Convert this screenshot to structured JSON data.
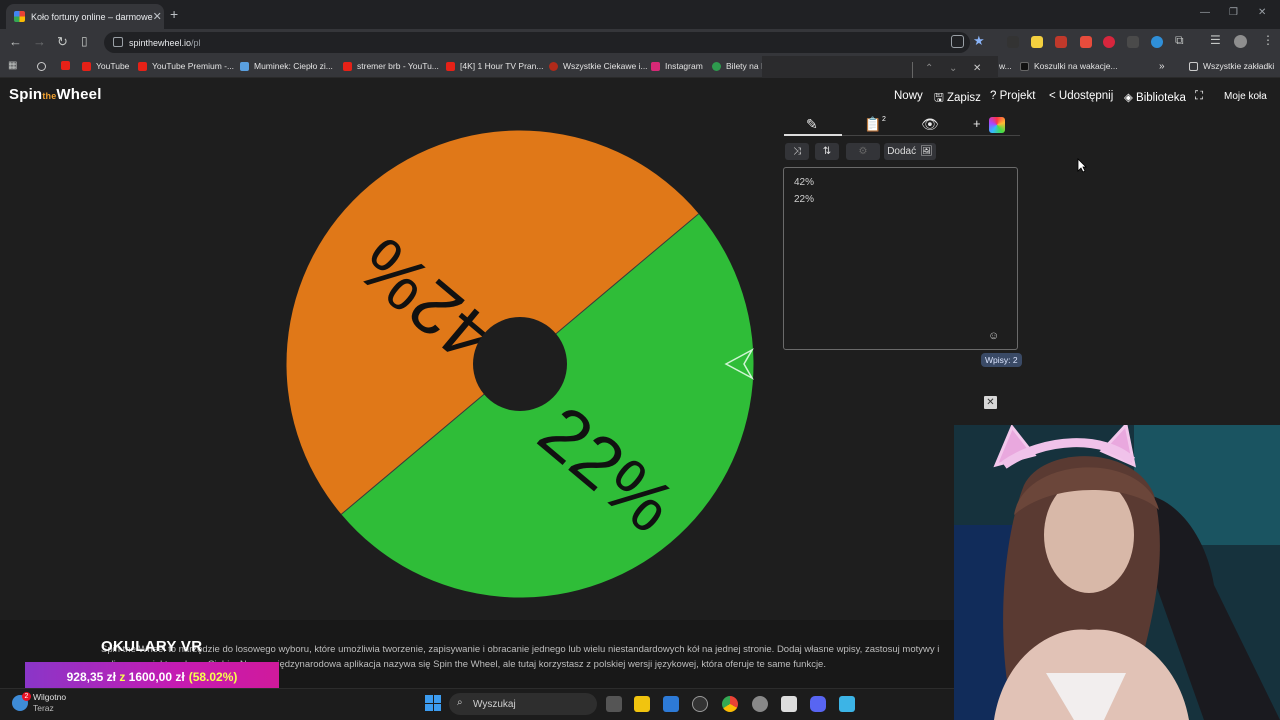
{
  "browser": {
    "tab_title": "Koło fortuny online – darmowe",
    "url_host": "spinthewheel.io",
    "url_path": "/pl",
    "bookmarks": [
      {
        "label": "YouTube",
        "color": "#e62117"
      },
      {
        "label": "YouTube Premium -...",
        "color": "#e62117"
      },
      {
        "label": "Muminek: Ciepło zi...",
        "color": "#5aa0e0"
      },
      {
        "label": "stremer brb - YouTu...",
        "color": "#e62117"
      },
      {
        "label": "[4K] 1 Hour TV Pran...",
        "color": "#e62117"
      },
      {
        "label": "Wszystkie Ciekawe i...",
        "color": "#b02a1a"
      },
      {
        "label": "Instagram",
        "color": "#d62976"
      },
      {
        "label": "Bilety na I",
        "color": "#2e9b4e"
      }
    ],
    "bookmark_right": "Koszulki na wakacje...",
    "bookmark_w_fragment": "w...",
    "all_bookmarks": "Wszystkie zakładki"
  },
  "site": {
    "logo_left": "Spin",
    "logo_mid": "the",
    "logo_right": "Wheel",
    "menu": {
      "new": "Nowy",
      "save": "Zapisz",
      "project": "Projekt",
      "share": "Udostępnij",
      "library": "Biblioteka",
      "my_wheels": "Moje koła"
    }
  },
  "wheel": {
    "segments": [
      {
        "label": "42%",
        "color": "#e07818"
      },
      {
        "label": "22%",
        "color": "#2fbd38"
      }
    ],
    "pointer_color": "#2fbd38"
  },
  "editor": {
    "add_button": "Dodać",
    "entries": [
      "42%",
      "22%"
    ],
    "entries_count": "Wpisy: 2",
    "clipboard_badge": "2"
  },
  "description": {
    "overlay_title": "OKULARY VR",
    "line1": "Spin the Wheel to narzędzie do losowego wyboru, które umożliwia tworzenie, zapisywanie i obracanie jednego lub wielu niestandardowych kół na jednej stronie. Dodaj własne wpisy, zastosuj motywy i",
    "line2": "online zaprojektowało za Ciebie. Nasza międzynarodowa aplikacja nazywa się Spin the Wheel, ale tutaj korzystasz z polskiej wersji językowej, która oferuje te same funkcje."
  },
  "donation": {
    "current": "928,35 zł",
    "sep": "z",
    "goal": "1600,00 zł",
    "percent": "(58.02%)"
  },
  "taskbar": {
    "search_placeholder": "Wyszukaj",
    "notif_title": "Wilgotno",
    "notif_sub": "Teraz"
  }
}
